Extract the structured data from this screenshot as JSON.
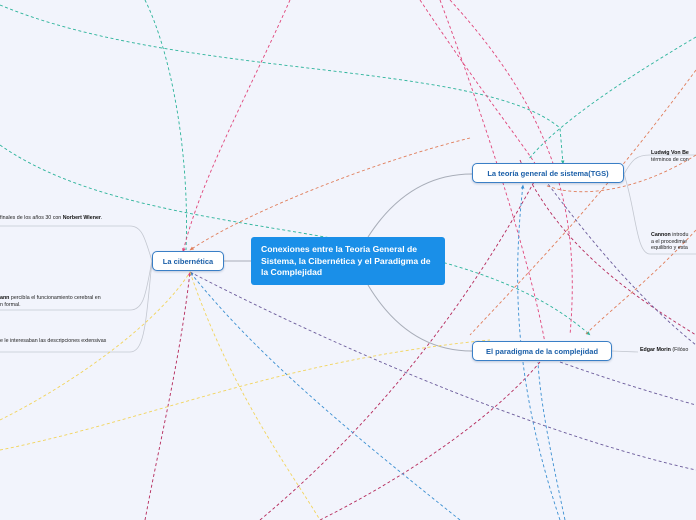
{
  "central_topic": "Conexiones entre la Teoria General de Sistema, la Cibernética y el Paradigma de la Complejidad",
  "branches": {
    "cibernetica": "La cibernética",
    "tgs": "La teoría general de sistema(TGS)",
    "complejidad": "El paradigma de la complejidad"
  },
  "leaves": {
    "cib_1_pre": "finales de  los años 30 con ",
    "cib_1_name": "Norbert Wiener",
    "cib_1_post": ".",
    "cib_2_name": "ann",
    "cib_2_text": " percibía el funcionamiento cerebral en",
    "cib_2_line2": "n formal.",
    "cib_3": "e le interesaban las descripciones extensivas",
    "tgs_1_name": "Ludwig Von Be",
    "tgs_1_line2": "términos de con",
    "tgs_2_name": "Cannon",
    "tgs_2_text": " introdu",
    "tgs_2_line2": "a el procedimie",
    "tgs_2_line3": "equilibrio y esta",
    "comp_1_name": "Edgar Morin",
    "comp_1_text": " (Filóso"
  },
  "colors": {
    "background": "#f2f4fc",
    "central_fill": "#1a8fe8",
    "node_border": "#3a7fc6",
    "node_text": "#1b5fa8",
    "link_teal": "#2bb39a",
    "link_magenta": "#e0457a",
    "link_crimson": "#b5285a",
    "link_blue": "#3b8fd1",
    "link_purple": "#6a5a9a",
    "link_yellow": "#f2d45c",
    "link_orange": "#e07d5a",
    "connector_gray": "#a8adb8"
  }
}
